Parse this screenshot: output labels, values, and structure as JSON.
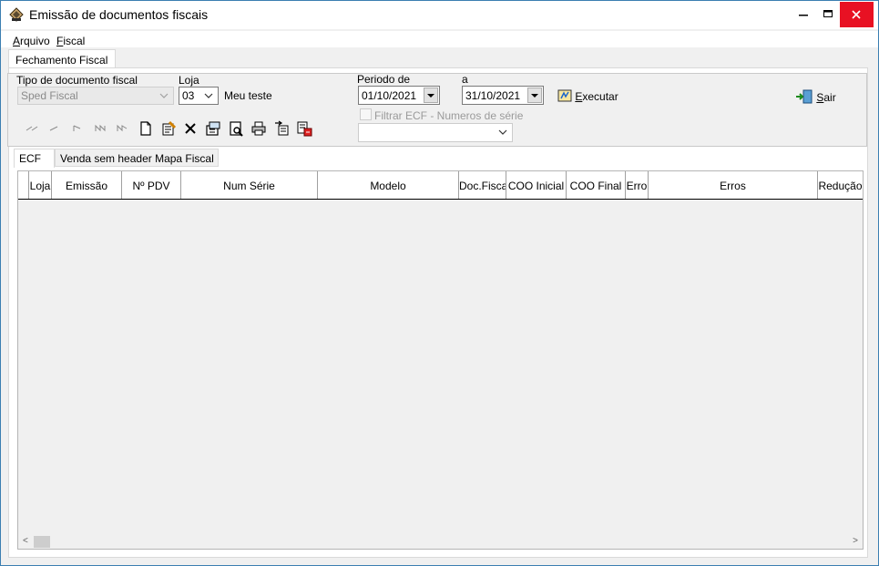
{
  "window": {
    "title": "Emissão de documentos fiscais",
    "controls": {
      "minimize": "minimize-icon",
      "maximize": "maximize-icon",
      "close": "close-icon"
    },
    "close_color": "#e81123"
  },
  "menu": {
    "items": [
      {
        "label": "Arquivo",
        "underline": "A",
        "rest": "rquivo"
      },
      {
        "label": "Fiscal",
        "underline": "F",
        "rest": "iscal"
      }
    ]
  },
  "main_tab": {
    "label": "Fechamento Fiscal"
  },
  "form": {
    "tipo_label": "Tipo de documento fiscal",
    "tipo_value": "Sped Fiscal",
    "loja_label": "Loja",
    "loja_value": "03",
    "loja_name": "Meu teste",
    "periodo_label": "Periodo  de",
    "periodo_from": "01/10/2021",
    "a_label": "a",
    "periodo_to": "31/10/2021",
    "executar_label": "Executar",
    "executar_underline": "E",
    "executar_rest": "xecutar",
    "sair_label": "Sair",
    "sair_underline": "S",
    "sair_rest": "air",
    "filtrar_label": "Filtrar ECF - Numeros de  série",
    "filtrar_value": ""
  },
  "toolbar_icons": [
    "first-record-icon",
    "prior-record-icon",
    "next-record-icon",
    "last-record-icon",
    "refresh-icon",
    "new-document-icon",
    "edit-document-icon",
    "delete-icon",
    "properties-icon",
    "print-preview-icon",
    "print-icon",
    "export-icon",
    "import-icon"
  ],
  "sub_tabs": [
    {
      "label": "ECF",
      "active": true
    },
    {
      "label": "Venda sem header Mapa Fiscal",
      "active": false
    }
  ],
  "grid": {
    "columns": [
      "Loja",
      "Emissão",
      "Nº PDV",
      "Num Série",
      "Modelo",
      "Doc.Fiscal",
      "COO Inicial",
      "COO Final",
      "Erro",
      "Erros",
      "Redução"
    ],
    "rows": []
  }
}
